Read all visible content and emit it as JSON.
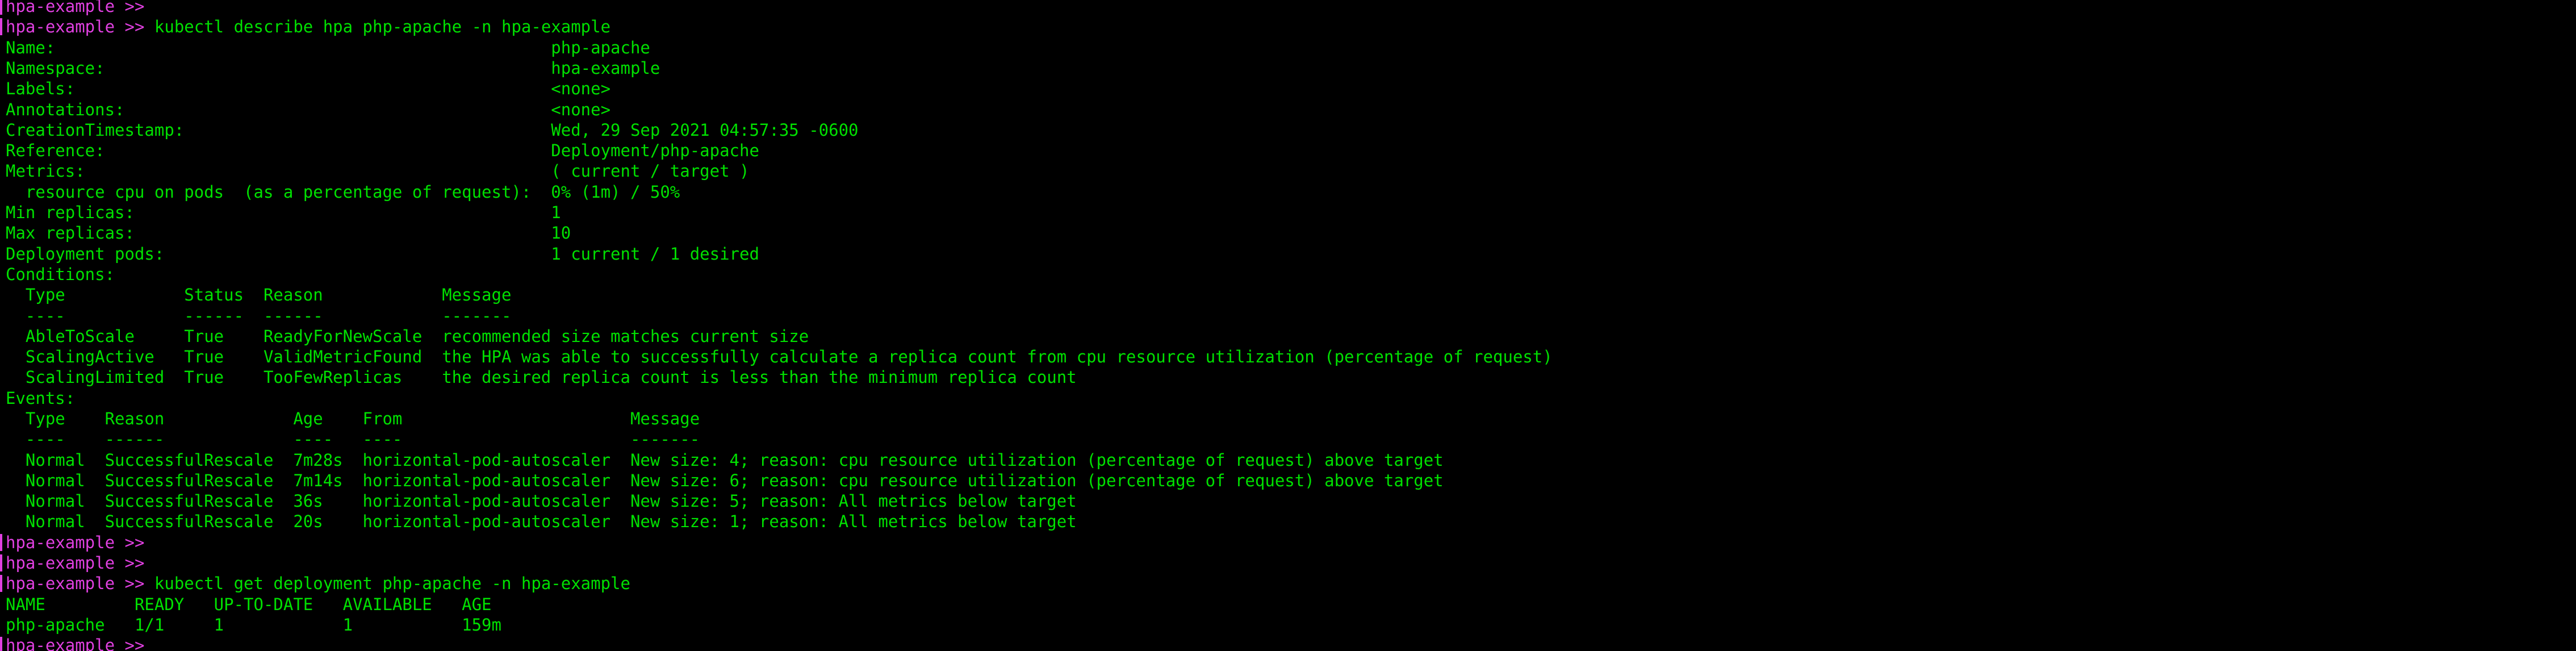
{
  "colors": {
    "background": "#000000",
    "text": "#00e000",
    "prompt": "#e040e0"
  },
  "terminal": {
    "prompt": "hpa-example >>",
    "lines": [
      {
        "kind": "prompt",
        "prompt": "hpa-example >>",
        "command": ""
      },
      {
        "kind": "prompt",
        "prompt": "hpa-example >>",
        "command": " kubectl describe hpa php-apache -n hpa-example"
      },
      {
        "kind": "output",
        "text": "Name:                                                  php-apache"
      },
      {
        "kind": "output",
        "text": "Namespace:                                             hpa-example"
      },
      {
        "kind": "output",
        "text": "Labels:                                                <none>"
      },
      {
        "kind": "output",
        "text": "Annotations:                                           <none>"
      },
      {
        "kind": "output",
        "text": "CreationTimestamp:                                     Wed, 29 Sep 2021 04:57:35 -0600"
      },
      {
        "kind": "output",
        "text": "Reference:                                             Deployment/php-apache"
      },
      {
        "kind": "output",
        "text": "Metrics:                                               ( current / target )"
      },
      {
        "kind": "output",
        "text": "  resource cpu on pods  (as a percentage of request):  0% (1m) / 50%"
      },
      {
        "kind": "output",
        "text": "Min replicas:                                          1"
      },
      {
        "kind": "output",
        "text": "Max replicas:                                          10"
      },
      {
        "kind": "output",
        "text": "Deployment pods:                                       1 current / 1 desired"
      },
      {
        "kind": "output",
        "text": "Conditions:"
      },
      {
        "kind": "output",
        "text": "  Type            Status  Reason            Message"
      },
      {
        "kind": "output",
        "text": "  ----            ------  ------            -------"
      },
      {
        "kind": "output",
        "text": "  AbleToScale     True    ReadyForNewScale  recommended size matches current size"
      },
      {
        "kind": "output",
        "text": "  ScalingActive   True    ValidMetricFound  the HPA was able to successfully calculate a replica count from cpu resource utilization (percentage of request)"
      },
      {
        "kind": "output",
        "text": "  ScalingLimited  True    TooFewReplicas    the desired replica count is less than the minimum replica count"
      },
      {
        "kind": "output",
        "text": "Events:"
      },
      {
        "kind": "output",
        "text": "  Type    Reason             Age    From                       Message"
      },
      {
        "kind": "output",
        "text": "  ----    ------             ----   ----                       -------"
      },
      {
        "kind": "output",
        "text": "  Normal  SuccessfulRescale  7m28s  horizontal-pod-autoscaler  New size: 4; reason: cpu resource utilization (percentage of request) above target"
      },
      {
        "kind": "output",
        "text": "  Normal  SuccessfulRescale  7m14s  horizontal-pod-autoscaler  New size: 6; reason: cpu resource utilization (percentage of request) above target"
      },
      {
        "kind": "output",
        "text": "  Normal  SuccessfulRescale  36s    horizontal-pod-autoscaler  New size: 5; reason: All metrics below target"
      },
      {
        "kind": "output",
        "text": "  Normal  SuccessfulRescale  20s    horizontal-pod-autoscaler  New size: 1; reason: All metrics below target"
      },
      {
        "kind": "prompt",
        "prompt": "hpa-example >>",
        "command": ""
      },
      {
        "kind": "prompt",
        "prompt": "hpa-example >>",
        "command": ""
      },
      {
        "kind": "prompt",
        "prompt": "hpa-example >>",
        "command": " kubectl get deployment php-apache -n hpa-example"
      },
      {
        "kind": "output",
        "text": "NAME         READY   UP-TO-DATE   AVAILABLE   AGE"
      },
      {
        "kind": "output",
        "text": "php-apache   1/1     1            1           159m"
      },
      {
        "kind": "prompt",
        "prompt": "hpa-example >>",
        "command": ""
      }
    ]
  }
}
